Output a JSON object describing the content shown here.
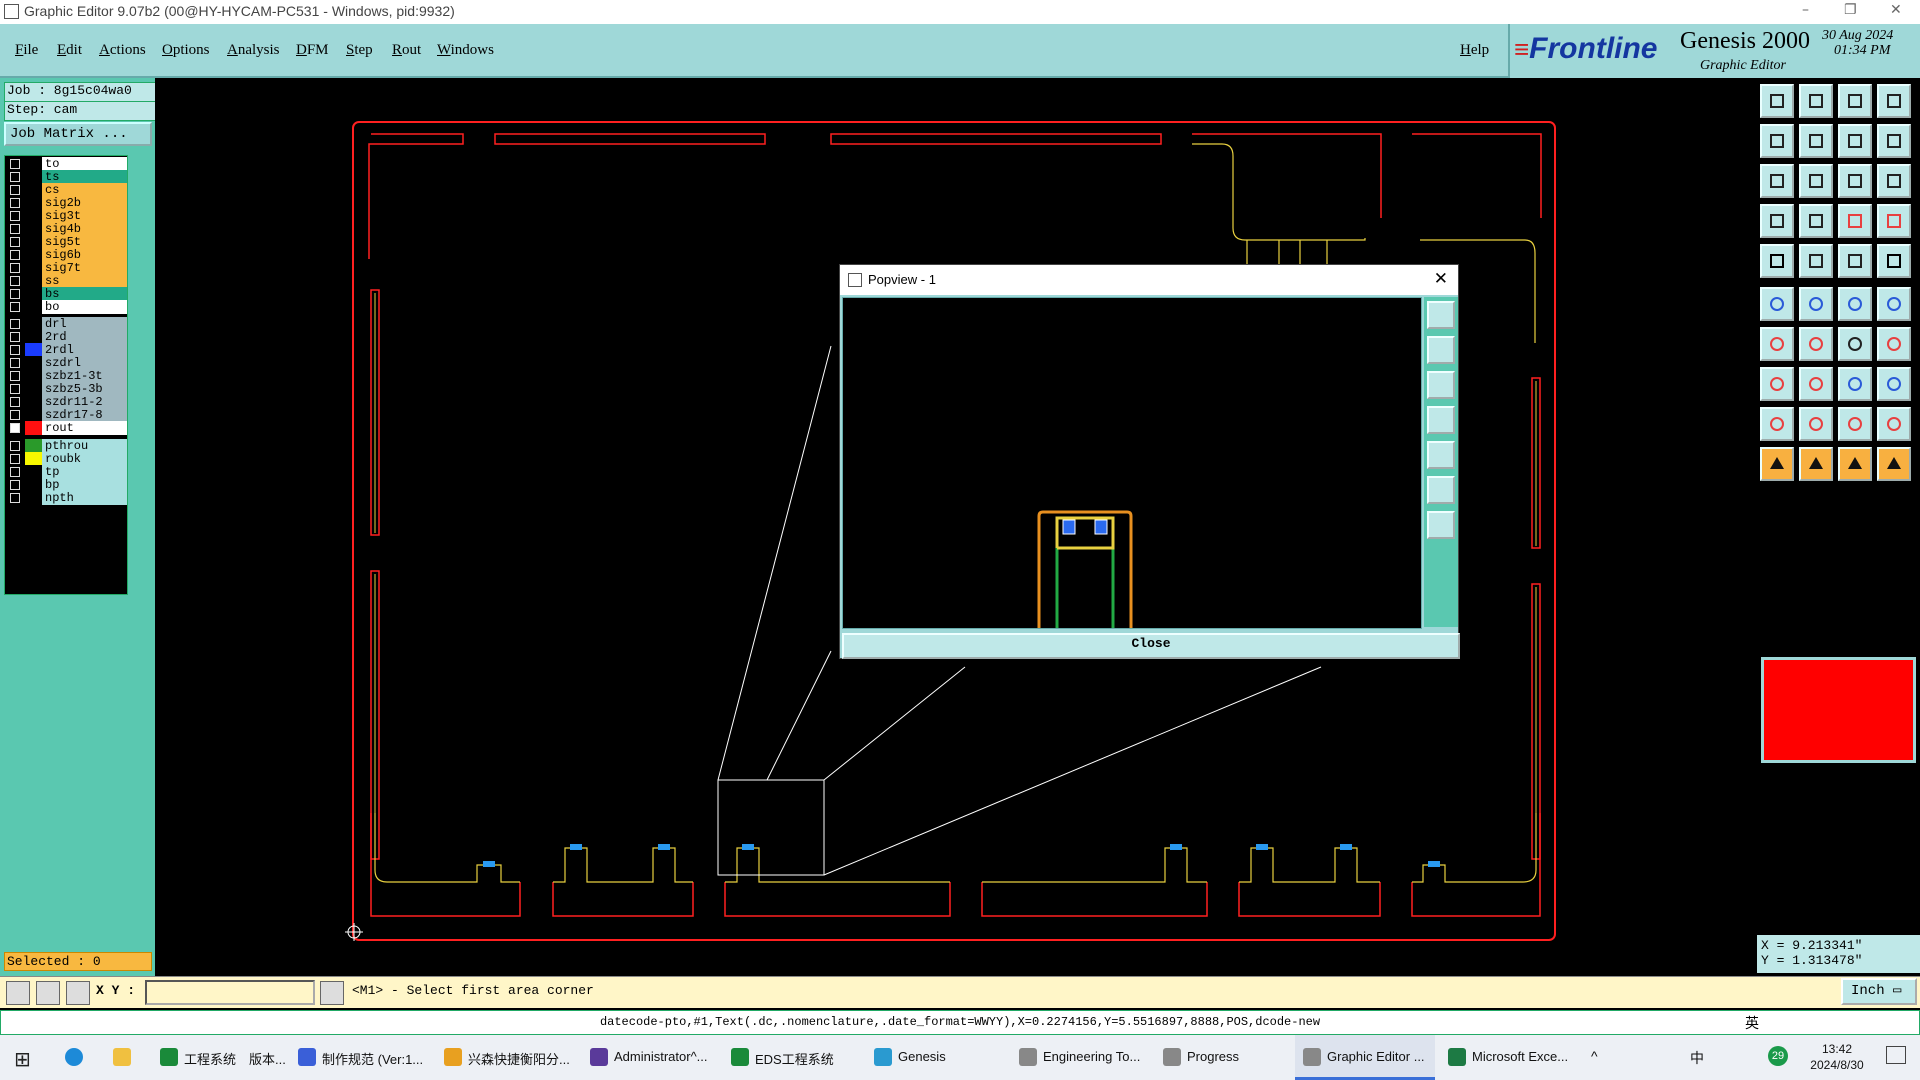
{
  "window": {
    "title": "Graphic Editor 9.07b2 (00@HY-HYCAM-PC531 - Windows, pid:9932)"
  },
  "menu": [
    "File",
    "Edit",
    "Actions",
    "Options",
    "Analysis",
    "DFM",
    "Step",
    "Rout",
    "Windows"
  ],
  "help": "Help",
  "brand": {
    "company": "Frontline",
    "product": "Genesis 2000",
    "subtitle": "Graphic Editor",
    "date": "30 Aug 2024",
    "time": "01:34 PM"
  },
  "job": {
    "job_label": "Job : 8g15c04wa0",
    "step_label": "Step: cam",
    "matrix_button": "Job Matrix ..."
  },
  "layers": [
    {
      "name": "to",
      "color": "#ffffff",
      "swatch": "#000000"
    },
    {
      "name": "ts",
      "color": "#22aa88",
      "swatch": "#000000"
    },
    {
      "name": "cs",
      "color": "#f8b840",
      "swatch": "#000000"
    },
    {
      "name": "sig2b",
      "color": "#f8b840",
      "swatch": "#000000"
    },
    {
      "name": "sig3t",
      "color": "#f8b840",
      "swatch": "#000000"
    },
    {
      "name": "sig4b",
      "color": "#f8b840",
      "swatch": "#000000"
    },
    {
      "name": "sig5t",
      "color": "#f8b840",
      "swatch": "#000000"
    },
    {
      "name": "sig6b",
      "color": "#f8b840",
      "swatch": "#000000"
    },
    {
      "name": "sig7t",
      "color": "#f8b840",
      "swatch": "#000000"
    },
    {
      "name": "ss",
      "color": "#f8b840",
      "swatch": "#000000"
    },
    {
      "name": "bs",
      "color": "#22aa88",
      "swatch": "#000000"
    },
    {
      "name": "bo",
      "color": "#ffffff",
      "swatch": "#000000"
    },
    {
      "name": "drl",
      "color": "#a0b8c0",
      "swatch": "#000000"
    },
    {
      "name": "2rd",
      "color": "#a0b8c0",
      "swatch": "#000000"
    },
    {
      "name": "2rdl",
      "color": "#a0b8c0",
      "swatch": "#1a3cff"
    },
    {
      "name": "szdrl",
      "color": "#a0b8c0",
      "swatch": "#000000"
    },
    {
      "name": "szbz1-3t",
      "color": "#a0b8c0",
      "swatch": "#000000"
    },
    {
      "name": "szbz5-3b",
      "color": "#a0b8c0",
      "swatch": "#000000"
    },
    {
      "name": "szdr11-2",
      "color": "#a0b8c0",
      "swatch": "#000000"
    },
    {
      "name": "szdr17-8",
      "color": "#a0b8c0",
      "swatch": "#000000"
    },
    {
      "name": "rout",
      "color": "#ffffff",
      "swatch": "#ff1010"
    },
    {
      "name": "pthrou",
      "color": "#a8e0e0",
      "swatch": "#2a9a2a"
    },
    {
      "name": "roubk",
      "color": "#a8e0e0",
      "swatch": "#f8f800"
    },
    {
      "name": "tp",
      "color": "#a8e0e0",
      "swatch": "#000000"
    },
    {
      "name": "bp",
      "color": "#a8e0e0",
      "swatch": "#000000"
    },
    {
      "name": "npth",
      "color": "#a8e0e0",
      "swatch": "#000000"
    }
  ],
  "selected": "Selected : 0",
  "coords": {
    "x": "X = 9.213341\"",
    "y": "Y = 1.313478\""
  },
  "command": {
    "xy_label": "X Y :",
    "xy_value": "",
    "prompt": "<M1> - Select first area corner",
    "unit": "Inch"
  },
  "status": "datecode-pto,#1,Text(.dc,.nomenclature,.date_format=WWYY),X=0.2274156,Y=5.5516897,8888,POS,dcode-new",
  "popview": {
    "title": "Popview - 1",
    "close_label": "Close"
  },
  "taskbar": {
    "items": [
      {
        "label": "工程系统　版本...",
        "color": "#1a8a3a"
      },
      {
        "label": "制作规范 (Ver:1...",
        "color": "#3a5fd8"
      },
      {
        "label": "兴森快捷衡阳分...",
        "color": "#e8a020"
      },
      {
        "label": "Administrator^...",
        "color": "#5a3a9a"
      },
      {
        "label": "EDS工程系统",
        "color": "#1a8a3a"
      },
      {
        "label": "Genesis",
        "color": "#2a9ad0"
      },
      {
        "label": "Engineering To...",
        "color": "#888888"
      },
      {
        "label": "Progress",
        "color": "#888888"
      },
      {
        "label": "Graphic Editor ...",
        "color": "#888888"
      },
      {
        "label": "Microsoft Exce...",
        "color": "#1d7a44"
      }
    ],
    "clock_time": "13:42",
    "clock_date": "2024/8/30",
    "ime": "中",
    "ime2": "英",
    "badge": "29"
  },
  "colors": {
    "panel": "#9fd8d8",
    "accent_red": "#ff0000",
    "rout": "#ff2020",
    "board_yellow": "#e8d040",
    "board_green": "#22aa44"
  }
}
